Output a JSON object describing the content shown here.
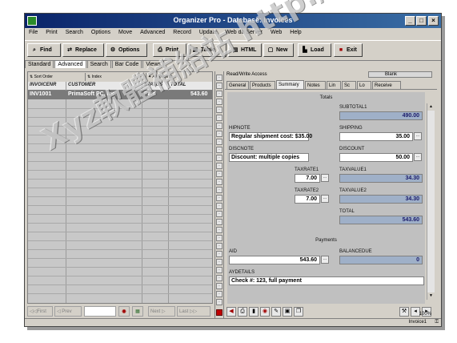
{
  "window": {
    "title": "Organizer Pro - Database: Invoices"
  },
  "menu": [
    "File",
    "Print",
    "Search",
    "Options",
    "Move",
    "Advanced",
    "Record",
    "Update",
    "Web db Server",
    "Web",
    "Help"
  ],
  "toolbar": {
    "find": "Find",
    "replace": "Replace",
    "options": "Options",
    "print": "Print",
    "table": "Table",
    "html": "HTML",
    "new": "New",
    "load": "Load",
    "exit": "Exit"
  },
  "view_tabs": [
    "Standard",
    "Advanced",
    "Search",
    "Bar Code",
    "Views"
  ],
  "list_buttons": [
    "Sort Order",
    "Index",
    "All Records"
  ],
  "grid": {
    "columns": [
      "INVOICENR",
      "CUSTOMER",
      "STATUS",
      "TOTAL"
    ],
    "rows": [
      {
        "invoicenr": "INV1001",
        "customer": "PrimaSoft PC, Inc.",
        "status": "Paid",
        "total": "543.60"
      }
    ]
  },
  "list_bottom": [
    "First",
    "Prev",
    "Next",
    "Last"
  ],
  "record": {
    "access": "Read/Write Access",
    "blank_label": "Blank",
    "tabs": [
      "General",
      "Products",
      "Summary",
      "Notes",
      "Lin",
      "Sc",
      "Lo",
      "Receive"
    ],
    "section_totals": "Totals",
    "subtotal1_label": "SUBTOTAL1",
    "subtotal1": "490.00",
    "shipping_text_label": "HIPNOTE",
    "shipping_note": "Regular shipment cost: $35.00",
    "shipping_label": "SHIPPING",
    "shipping": "35.00",
    "discount_text_label": "DISCNOTE",
    "discount_note": "Discount: multiple copies",
    "discount_label": "DISCOUNT",
    "discount": "50.00",
    "taxrate1_label": "TAXRATE1",
    "taxrate1": "7.00",
    "taxvalue1_label": "TAXVALUE1",
    "taxvalue1": "34.30",
    "taxrate2_label": "TAXRATE2",
    "taxrate2": "7.00",
    "taxvalue2_label": "TAXVALUE2",
    "taxvalue2": "34.30",
    "total_label": "TOTAL",
    "total": "543.60",
    "section_payments": "Payments",
    "paid_label": "AID",
    "paid": "543.60",
    "balance_label": "BALANCEDUE",
    "balance": "0",
    "paydetails_label": "AYDETAILS",
    "paydetails": "Check #: 123, full payment"
  },
  "status": {
    "zoom": "100%",
    "database": "Invoice1"
  },
  "watermark": "Xyz軟體補給站 http://231.to"
}
